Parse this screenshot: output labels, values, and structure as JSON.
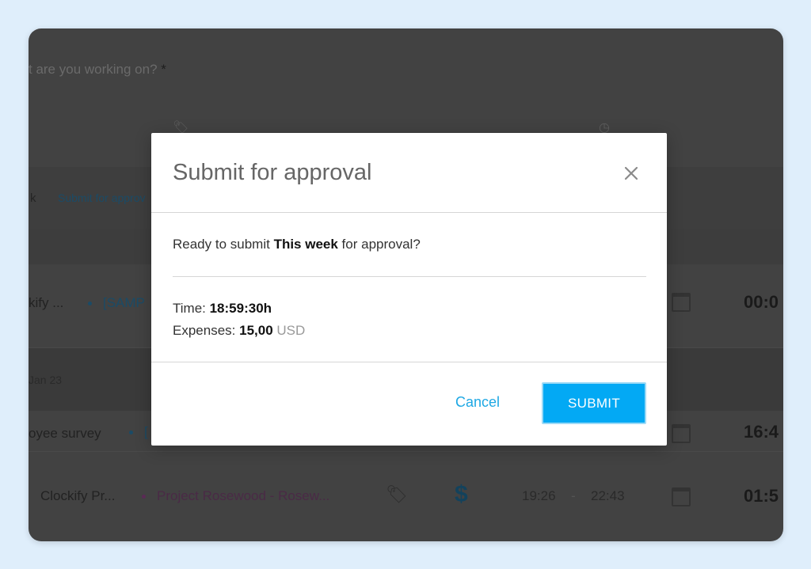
{
  "background": {
    "question_label": "t are you working on?",
    "required_mark": "*",
    "week_label": "k",
    "week_link": "Submit for approv",
    "rows": [
      {
        "desc": "kify ...",
        "project": "[SAMP",
        "time": "00:0"
      },
      {
        "desc": "oyee survey",
        "project": "[",
        "time": "16:4"
      },
      {
        "desc": "Clockify Pr...",
        "project": "Project Rosewood - Rosew...",
        "start": "19:26",
        "sep": "-",
        "end": "22:43",
        "time": "01:5"
      }
    ],
    "date_label": "Jan 23",
    "billable_symbol": "$",
    "colors": {
      "overlay": "#424242",
      "accent": "#03a9f4",
      "link": "#1ea8e4"
    }
  },
  "modal": {
    "title": "Submit for approval",
    "question_prefix": "Ready to submit ",
    "question_bold": "This week",
    "question_suffix": " for approval?",
    "time_label": "Time: ",
    "time_value": "18:59:30h",
    "expenses_label": "Expenses: ",
    "expenses_value": "15,00",
    "expenses_currency": "USD",
    "cancel_label": "Cancel",
    "submit_label": "SUBMIT"
  }
}
